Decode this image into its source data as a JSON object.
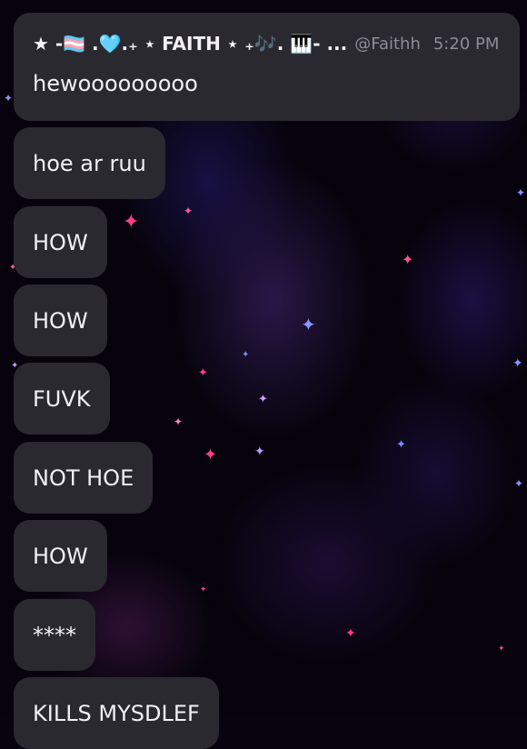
{
  "header": {
    "display_name": "★ -🏳️‍⚧️ .🩵.₊ ⋆ FAITH ⋆ ₊🎶. 🎹- ...",
    "handle": "@Faithh",
    "time": "5:20 PM",
    "first_message": "hewooooooooo"
  },
  "messages": [
    {
      "text": "hoe ar ruu"
    },
    {
      "text": "HOW"
    },
    {
      "text": "HOW"
    },
    {
      "text": "FUVK"
    },
    {
      "text": "NOT HOE"
    },
    {
      "text": "HOW"
    },
    {
      "text": "****"
    },
    {
      "text": "KILLS MYSDLEF"
    }
  ],
  "colors": {
    "bubble": "#2b2930",
    "text": "#f2f0f6",
    "muted": "#8f8b98",
    "star_pink": "#ff3d86",
    "star_blue": "#8a92ff"
  }
}
